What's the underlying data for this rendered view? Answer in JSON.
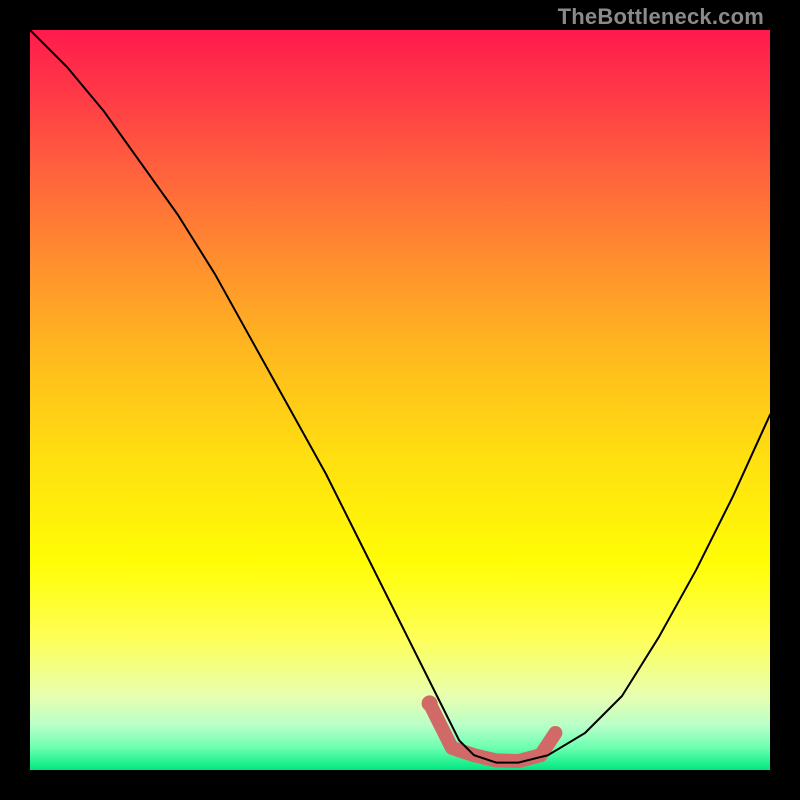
{
  "watermark": "TheBottleneck.com",
  "chart_data": {
    "type": "line",
    "title": "",
    "xlabel": "",
    "ylabel": "",
    "xlim": [
      0,
      100
    ],
    "ylim": [
      0,
      100
    ],
    "background_gradient": {
      "top": "#ff1a4d",
      "mid": "#ffe010",
      "bottom": "#00e880"
    },
    "series": [
      {
        "name": "bottleneck-curve",
        "x": [
          0,
          5,
          10,
          15,
          20,
          25,
          30,
          35,
          40,
          45,
          50,
          55,
          58,
          60,
          63,
          66,
          70,
          75,
          80,
          85,
          90,
          95,
          100
        ],
        "values": [
          100,
          95,
          89,
          82,
          75,
          67,
          58,
          49,
          40,
          30,
          20,
          10,
          4,
          2,
          1,
          1,
          2,
          5,
          10,
          18,
          27,
          37,
          48
        ]
      }
    ],
    "highlight_region": {
      "name": "optimal-zone",
      "color": "#d16a66",
      "x": [
        54,
        57,
        60,
        63,
        66,
        69,
        71
      ],
      "values": [
        9,
        3,
        2,
        1.3,
        1.2,
        2,
        5
      ]
    }
  }
}
